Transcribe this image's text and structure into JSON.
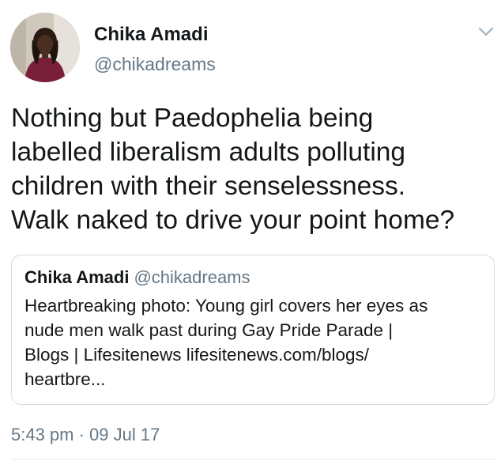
{
  "author": {
    "display_name": "Chika Amadi",
    "handle": "@chikadreams",
    "avatar_icon": "profile-photo"
  },
  "menu": {
    "icon": "chevron-down-icon"
  },
  "tweet": {
    "text_lines": [
      "Nothing but Paedophelia being",
      "labelled liberalism adults polluting",
      "children with their senselessness.",
      "Walk naked to drive your point home?"
    ],
    "timestamp": "5:43 pm · 09 Jul 17"
  },
  "quoted_tweet": {
    "display_name": "Chika Amadi",
    "handle": "@chikadreams",
    "text_lines": [
      "Heartbreaking photo: Young girl covers her eyes as",
      "nude men walk past during Gay Pride Parade |",
      "Blogs | Lifesitenews lifesitenews.com/blogs/",
      "heartbre..."
    ]
  },
  "colors": {
    "text_primary": "#14171a",
    "text_secondary": "#657786",
    "border": "#d4dbe1"
  }
}
